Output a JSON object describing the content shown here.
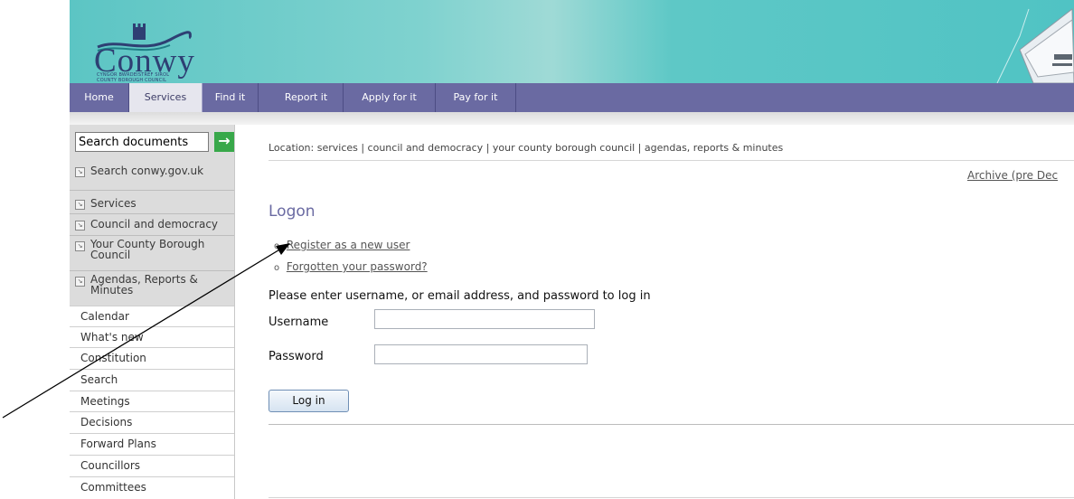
{
  "header": {
    "logo_text": "Conwy",
    "logo_sub1": "CYNGOR BWRDEISTREF SIROL",
    "logo_sub2": "COUNTY BOROUGH COUNCIL"
  },
  "nav": {
    "tabs": [
      {
        "label": "Home"
      },
      {
        "label": "Services",
        "active": true
      },
      {
        "label": "Find it"
      },
      {
        "label": "Report it"
      },
      {
        "label": "Apply for it"
      },
      {
        "label": "Pay for it"
      }
    ]
  },
  "sidebar": {
    "search_value": "Search documents",
    "search_go": "→",
    "search_site": "Search conwy.gov.uk",
    "sections": [
      "Services",
      "Council and democracy",
      "Your County Borough Council",
      "Agendas, Reports & Minutes"
    ],
    "links": [
      "Calendar",
      "What's new",
      "Constitution",
      "Search",
      "Meetings",
      "Decisions",
      "Forward Plans",
      "Councillors",
      "Committees"
    ]
  },
  "main": {
    "location": "Location: services | council and democracy | your county borough council | agendas, reports & minutes",
    "archive_link": "Archive (pre Dec",
    "title": "Logon",
    "links": [
      "Register as a new user",
      "Forgotten your password?"
    ],
    "instructions": "Please enter username, or email address, and password to log in",
    "username_label": "Username",
    "password_label": "Password",
    "username_value": "",
    "password_value": "",
    "login_button": "Log in"
  },
  "colors": {
    "nav_bg": "#6a6aa2",
    "banner": "#5cc5c4",
    "title": "#6a6aa2",
    "go_button": "#38a84a"
  }
}
